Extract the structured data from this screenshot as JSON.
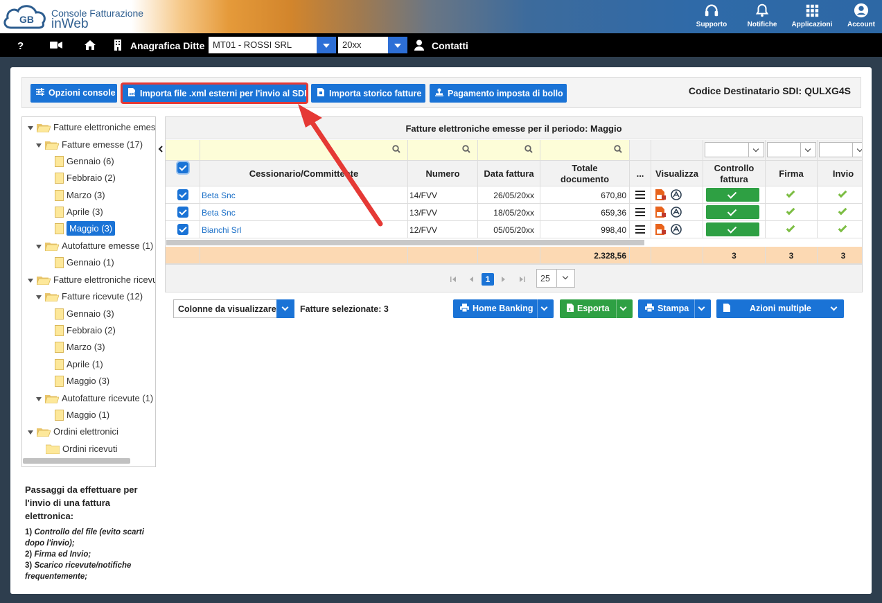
{
  "header": {
    "brand_line1": "Console Fatturazione",
    "brand_line2": "inWeb",
    "logo_text": "GB",
    "icons": [
      {
        "name": "headset-icon",
        "label": "Supporto"
      },
      {
        "name": "bell-icon",
        "label": "Notifiche"
      },
      {
        "name": "grid-icon",
        "label": "Applicazioni"
      },
      {
        "name": "user-circle-icon",
        "label": "Account"
      }
    ]
  },
  "nav": {
    "help": "?",
    "anagrafica": "Anagrafica Ditte",
    "company_select": "MT01 - ROSSI SRL",
    "year_select": "20xx",
    "contatti": "Contatti"
  },
  "toolbar": {
    "opzioni": "Opzioni console",
    "importa_xml": "Importa file .xml esterni per l'invio al SDI",
    "importa_storico": "Importa storico fatture",
    "pagamento_bollo": "Pagamento imposta di bollo",
    "codice_destinatario": "Codice Destinatario SDI: QULXG4S"
  },
  "tree": {
    "root_emesse": "Fatture elettroniche emesse",
    "fatture_emesse": "Fatture emesse (17)",
    "emesse_months": [
      "Gennaio (6)",
      "Febbraio (2)",
      "Marzo (3)",
      "Aprile (3)",
      "Maggio (3)"
    ],
    "autofatture_emesse": "Autofatture emesse (1)",
    "autofatture_emesse_months": [
      "Gennaio (1)"
    ],
    "root_ricevute": "Fatture elettroniche ricevute",
    "fatture_ricevute": "Fatture ricevute (12)",
    "ricevute_months": [
      "Gennaio (3)",
      "Febbraio (2)",
      "Marzo (3)",
      "Aprile (1)",
      "Maggio (3)"
    ],
    "autofatture_ricevute": "Autofatture ricevute (1)",
    "autofatture_ricevute_months": [
      "Maggio (1)"
    ],
    "ordini": "Ordini elettronici",
    "ordini_ricevuti": "Ordini ricevuti"
  },
  "instructions": {
    "title": "Passaggi da effettuare per l'invio di una fattura elettronica:",
    "step1_num": "1)",
    "step1": "Controllo del file (evito scarti dopo l'invio);",
    "step2_num": "2)",
    "step2": "Firma ed Invio;",
    "step3_num": "3)",
    "step3": "Scarico ricevute/notifiche frequentemente;"
  },
  "grid": {
    "title": "Fatture elettroniche emesse per il periodo: Maggio",
    "headers": {
      "cessionario": "Cessionario/Committente",
      "numero": "Numero",
      "data": "Data fattura",
      "totale": "Totale documento",
      "more": "...",
      "visualizza": "Visualizza",
      "controllo": "Controllo fattura",
      "firma": "Firma",
      "invio": "Invio"
    },
    "rows": [
      {
        "cessionario": "Beta Snc",
        "numero": "14/FVV",
        "data": "26/05/20xx",
        "totale": "670,80"
      },
      {
        "cessionario": "Beta Snc",
        "numero": "13/FVV",
        "data": "18/05/20xx",
        "totale": "659,36"
      },
      {
        "cessionario": "Bianchi Srl",
        "numero": "12/FVV",
        "data": "05/05/20xx",
        "totale": "998,40"
      }
    ],
    "totals": {
      "totale": "2.328,56",
      "controllo": "3",
      "firma": "3",
      "invio": "3"
    },
    "pager": {
      "current_page": "1",
      "page_size": "25"
    }
  },
  "gridtools": {
    "colonne": "Colonne da visualizzare",
    "selezionate": "Fatture selezionate: 3",
    "home_banking": "Home Banking",
    "esporta": "Esporta",
    "stampa": "Stampa",
    "azioni": "Azioni multiple"
  },
  "colors": {
    "accent": "#1a73d6",
    "green": "#2ea043",
    "highlight": "#e53935",
    "totals_row": "#fcd9b3"
  }
}
